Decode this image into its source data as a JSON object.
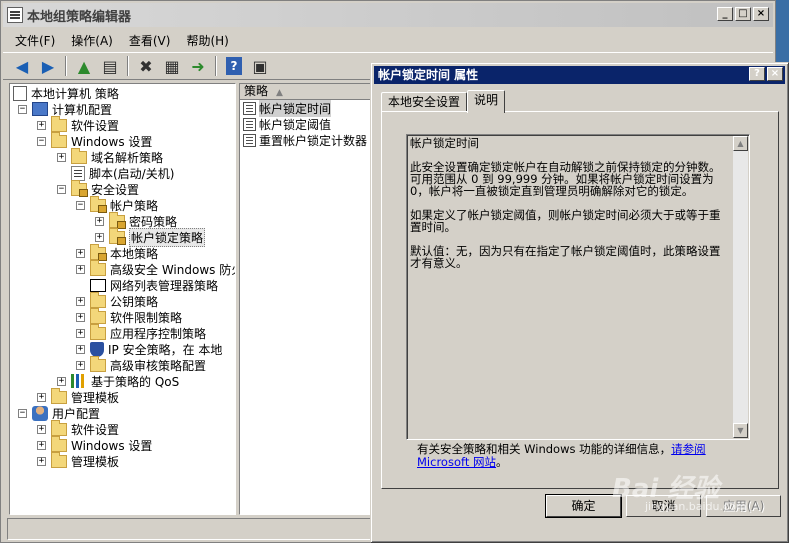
{
  "window": {
    "title": "本地组策略编辑器",
    "min": "_",
    "max": "□",
    "close": "×"
  },
  "menu": [
    "文件(F)",
    "操作(A)",
    "查看(V)",
    "帮助(H)"
  ],
  "tree": {
    "root": "本地计算机 策略",
    "computer_config": "计算机配置",
    "software_settings": "软件设置",
    "windows_settings": "Windows 设置",
    "dns_policy": "域名解析策略",
    "scripts": "脚本(启动/关机)",
    "security_settings": "安全设置",
    "account_policies": "帐户策略",
    "password_policy": "密码策略",
    "lockout_policy": "帐户锁定策略",
    "local_policies": "本地策略",
    "firewall": "高级安全 Windows 防火",
    "netlist": "网络列表管理器策略",
    "pubkey": "公钥策略",
    "srp": "软件限制策略",
    "applocker": "应用程序控制策略",
    "ipsec": "IP 安全策略，在 本地",
    "audit": "高级审核策略配置",
    "qos": "基于策略的 QoS",
    "admin_templates": "管理模板",
    "user_config": "用户配置",
    "u_software": "软件设置",
    "u_windows": "Windows 设置",
    "u_admin": "管理模板"
  },
  "list": {
    "header": "策略",
    "items": [
      "帐户锁定时间",
      "帐户锁定阈值",
      "重置帐户锁定计数器"
    ]
  },
  "dialog": {
    "title": "帐户锁定时间 属性",
    "help": "?",
    "close": "×",
    "tabs": [
      "本地安全设置",
      "说明"
    ],
    "desc_title": "帐户锁定时间",
    "desc_p1": "此安全设置确定锁定帐户在自动解锁之前保持锁定的分钟数。可用范围从 0 到 99,999 分钟。如果将帐户锁定时间设置为 0，帐户将一直被锁定直到管理员明确解除对它的锁定。",
    "desc_p2": "如果定义了帐户锁定阈值，则帐户锁定时间必须大于或等于重置时间。",
    "desc_p3": "默认值：无，因为只有在指定了帐户锁定阈值时，此策略设置才有意义。",
    "help_text": "有关安全策略和相关 Windows 功能的详细信息，",
    "help_link": "请参阅 Microsoft 网站",
    "help_end": "。",
    "ok": "确定",
    "cancel": "取消",
    "apply": "应用(A)"
  },
  "watermark": {
    "brand": "Bai 经验",
    "url": "jingyan.baidu.com"
  }
}
